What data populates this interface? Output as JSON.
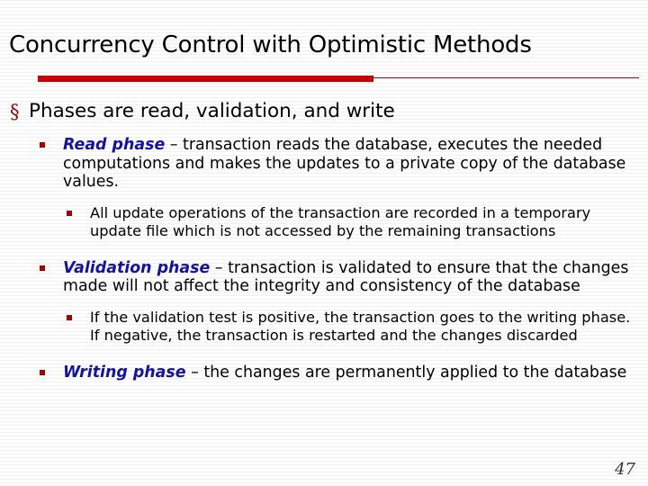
{
  "slide": {
    "title": "Concurrency Control with Optimistic Methods",
    "page_number": "47",
    "colors": {
      "rule_thick": "#cc0000",
      "rule_thin": "#7d1414",
      "bullet": "#a30000",
      "lead_term": "#1414a0",
      "body_text": "#000000",
      "background": "#ffffff"
    }
  },
  "content": {
    "level1": {
      "marker": "section-sign",
      "text": "Phases are read, validation, and write"
    },
    "items": [
      {
        "marker": "square-bullet",
        "lead": "Read phase",
        "rest": " – transaction reads the database, executes the needed computations and makes the updates to a private copy of the database values.",
        "sub": [
          {
            "marker": "square-bullet",
            "text": "All update operations of the transaction are recorded in a temporary update file which is not accessed by the remaining transactions"
          }
        ]
      },
      {
        "marker": "square-bullet",
        "lead": "Validation phase",
        "rest": " – transaction is validated to ensure that the changes made will not affect the integrity and consistency of the database",
        "sub": [
          {
            "marker": "square-bullet",
            "text": "If the validation test is positive, the transaction goes to the writing phase. If negative, the transaction is restarted and the changes discarded"
          }
        ]
      },
      {
        "marker": "square-bullet",
        "lead": "Writing phase",
        "rest": " – the changes are permanently applied to the database",
        "sub": []
      }
    ]
  }
}
